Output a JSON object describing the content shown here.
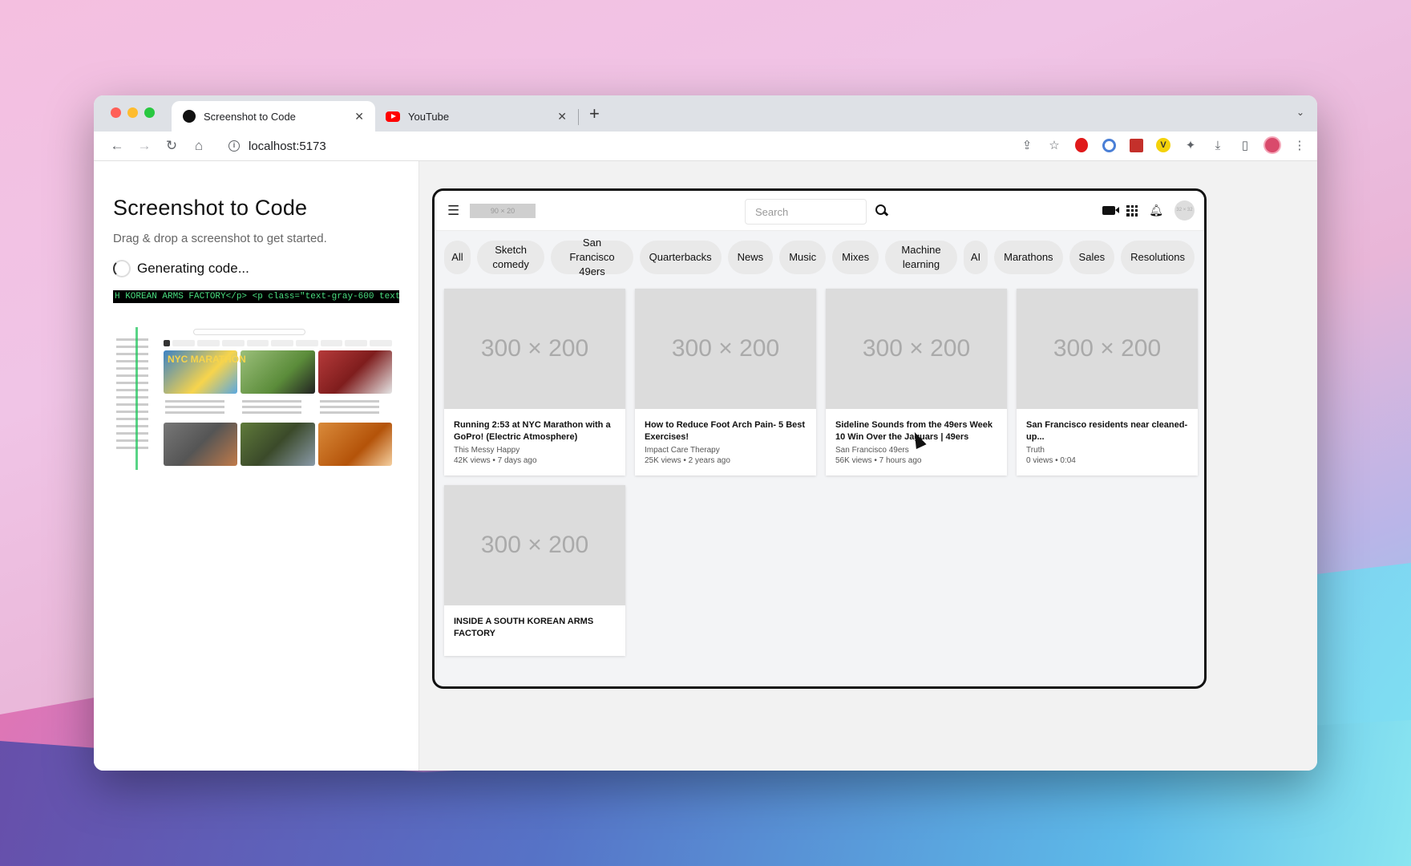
{
  "browser": {
    "tabs": [
      {
        "title": "Screenshot to Code"
      },
      {
        "title": "YouTube"
      }
    ],
    "new_tab": "+",
    "url": "localhost:5173"
  },
  "app": {
    "title": "Screenshot to Code",
    "subtitle": "Drag & drop a screenshot to get started.",
    "status": "Generating code...",
    "code_stream": "H KOREAN ARMS FACTORY</p> <p class=\"text-gray-600 text"
  },
  "preview": {
    "logo_placeholder": "90 × 20",
    "search_placeholder": "Search",
    "avatar_placeholder": "32 × 32",
    "chips": [
      "All",
      "Sketch comedy",
      "San Francisco 49ers",
      "Quarterbacks",
      "News",
      "Music",
      "Mixes",
      "Machine learning",
      "AI",
      "Marathons",
      "Sales",
      "Resolutions"
    ],
    "videos": [
      {
        "thumb": "300 × 200",
        "title": "Running 2:53 at NYC Marathon with a GoPro! (Electric Atmosphere)",
        "channel": "This Messy Happy",
        "stats": "42K views • 7 days ago"
      },
      {
        "thumb": "300 × 200",
        "title": "How to Reduce Foot Arch Pain- 5 Best Exercises!",
        "channel": "Impact Care Therapy",
        "stats": "25K views • 2 years ago"
      },
      {
        "thumb": "300 × 200",
        "title": "Sideline Sounds from the 49ers Week 10 Win Over the Jaguars | 49ers",
        "channel": "San Francisco 49ers",
        "stats": "56K views • 7 hours ago"
      },
      {
        "thumb": "300 × 200",
        "title": "San Francisco residents near cleaned-up...",
        "channel": "Truth",
        "stats": "0 views • 0:04"
      },
      {
        "thumb": "300 × 200",
        "title": "INSIDE A SOUTH KOREAN ARMS FACTORY",
        "channel": "",
        "stats": ""
      }
    ]
  },
  "thumbnail": {
    "headline": "NYC MARATHON"
  }
}
